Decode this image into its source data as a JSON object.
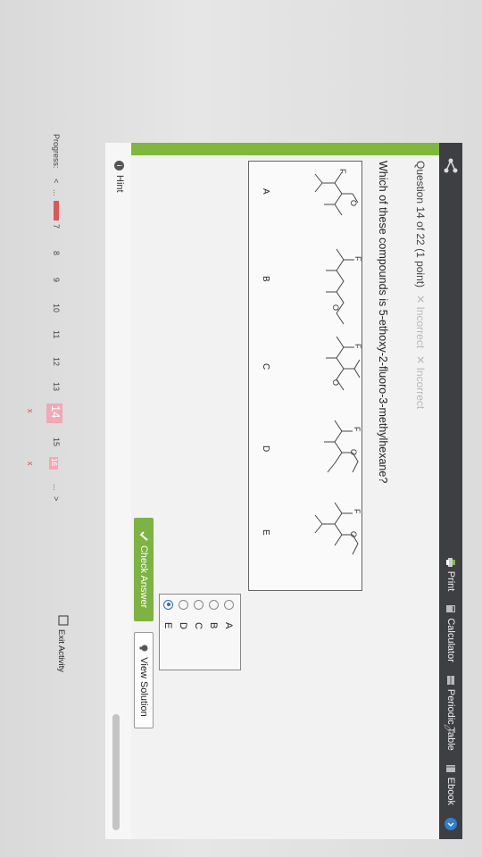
{
  "toolbar": {
    "print": "Print",
    "calculator": "Calculator",
    "periodic": "Periodic Table",
    "ebook": "Ebook"
  },
  "question": {
    "header": "Question 14 of 22 (1 point)",
    "status1": "Incorrect",
    "status2": "Incorrect",
    "prompt": "Which of these compounds is 5-ethoxy-2-fluoro-3-methylhexane?"
  },
  "structures": {
    "labels": [
      "A",
      "B",
      "C",
      "D",
      "E"
    ],
    "atom_f": "F",
    "atom_o": "O"
  },
  "choices": [
    {
      "label": "A",
      "selected": false
    },
    {
      "label": "B",
      "selected": false
    },
    {
      "label": "C",
      "selected": false
    },
    {
      "label": "D",
      "selected": false
    },
    {
      "label": "E",
      "selected": true
    }
  ],
  "buttons": {
    "check": "Check Answer",
    "view": "View Solution",
    "hint": "Hint",
    "exit": "Exit Activity"
  },
  "progress": {
    "label": "Progress:",
    "prev": "<",
    "next": ">",
    "ellipsis_left": "...",
    "ellipsis_right": "...",
    "pages": [
      "7",
      "8",
      "9",
      "10",
      "11",
      "12",
      "13",
      "14",
      "15",
      "16"
    ],
    "current": "14",
    "mark": "x"
  },
  "colors": {
    "topbar": "#3d3f42",
    "accent_green": "#7fb83a",
    "progress_red": "#e05555",
    "progress_pink": "#f4a7b4",
    "link_blue": "#2a6ebb"
  }
}
